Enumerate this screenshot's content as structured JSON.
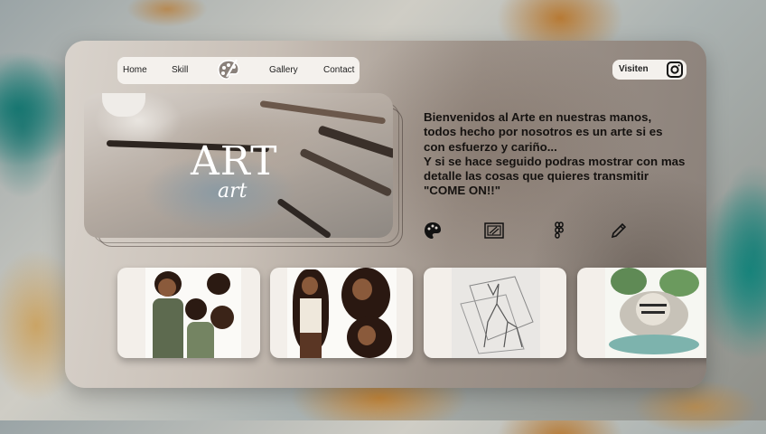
{
  "nav": {
    "items": [
      "Home",
      "Skill",
      "Gallery",
      "Contact"
    ],
    "logo_icon": "palette-icon"
  },
  "visit": {
    "label": "Visiten",
    "icon": "instagram-icon"
  },
  "hero": {
    "title": "ART",
    "subtitle": "art"
  },
  "intro": {
    "text": "Bienvenidos al Arte en nuestras manos, todos hecho por nosotros es un arte si es con esfuerzo y cariño...\nY si se hace seguido podras mostrar con mas detalle las cosas que quieres transmitir \"COME ON!!\""
  },
  "tools": [
    "palette-icon",
    "canvas-icon",
    "figma-icon",
    "pencil-icon"
  ],
  "gallery": [
    {
      "name": "character-sheet-girl"
    },
    {
      "name": "character-sheet-long-hair"
    },
    {
      "name": "wolf-sketch"
    },
    {
      "name": "tiger-painting"
    }
  ],
  "colors": {
    "card_light": "#d9d3cc",
    "card_dark": "#8a8079",
    "pill_bg": "#f4f1ed",
    "text": "#151210"
  }
}
